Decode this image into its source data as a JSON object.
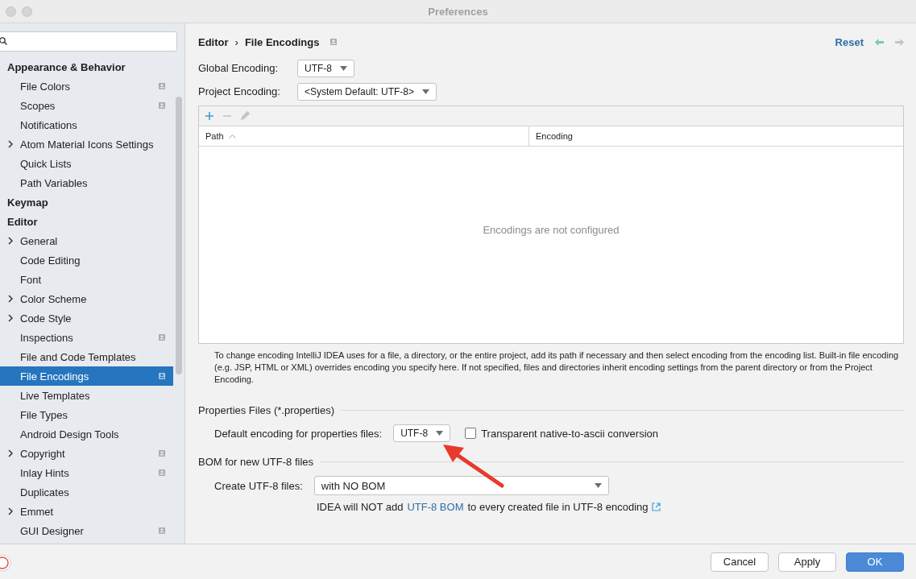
{
  "window": {
    "title": "Preferences"
  },
  "sidebar": {
    "items": [
      {
        "label": "Appearance & Behavior",
        "children": [
          {
            "label": "File Colors",
            "expandable": false,
            "badge": true,
            "selected": false
          },
          {
            "label": "Scopes",
            "expandable": false,
            "badge": true,
            "selected": false
          },
          {
            "label": "Notifications",
            "expandable": false,
            "badge": false,
            "selected": false
          },
          {
            "label": "Atom Material Icons Settings",
            "expandable": true,
            "badge": false,
            "selected": false
          },
          {
            "label": "Quick Lists",
            "expandable": false,
            "badge": false,
            "selected": false
          },
          {
            "label": "Path Variables",
            "expandable": false,
            "badge": false,
            "selected": false
          }
        ]
      },
      {
        "label": "Keymap"
      },
      {
        "label": "Editor",
        "children": [
          {
            "label": "General",
            "expandable": true,
            "badge": false,
            "selected": false
          },
          {
            "label": "Code Editing",
            "expandable": false,
            "badge": false,
            "selected": false
          },
          {
            "label": "Font",
            "expandable": false,
            "badge": false,
            "selected": false
          },
          {
            "label": "Color Scheme",
            "expandable": true,
            "badge": false,
            "selected": false
          },
          {
            "label": "Code Style",
            "expandable": true,
            "badge": false,
            "selected": false
          },
          {
            "label": "Inspections",
            "expandable": false,
            "badge": true,
            "selected": false
          },
          {
            "label": "File and Code Templates",
            "expandable": false,
            "badge": false,
            "selected": false
          },
          {
            "label": "File Encodings",
            "expandable": false,
            "badge": true,
            "selected": true
          },
          {
            "label": "Live Templates",
            "expandable": false,
            "badge": false,
            "selected": false
          },
          {
            "label": "File Types",
            "expandable": false,
            "badge": false,
            "selected": false
          },
          {
            "label": "Android Design Tools",
            "expandable": false,
            "badge": false,
            "selected": false
          },
          {
            "label": "Copyright",
            "expandable": true,
            "badge": true,
            "selected": false
          },
          {
            "label": "Inlay Hints",
            "expandable": false,
            "badge": true,
            "selected": false
          },
          {
            "label": "Duplicates",
            "expandable": false,
            "badge": false,
            "selected": false
          },
          {
            "label": "Emmet",
            "expandable": true,
            "badge": false,
            "selected": false
          },
          {
            "label": "GUI Designer",
            "expandable": false,
            "badge": true,
            "selected": false
          }
        ]
      }
    ]
  },
  "breadcrumb": [
    "Editor",
    "File Encodings"
  ],
  "breadcrumb_separator": "›",
  "reset": "Reset",
  "global_encoding": {
    "label": "Global Encoding:",
    "value": "UTF-8"
  },
  "project_encoding": {
    "label": "Project Encoding:",
    "value": "<System Default: UTF-8>"
  },
  "table": {
    "toolbar": {
      "add_disabled": false,
      "remove_disabled": true,
      "edit_disabled": true
    },
    "columns": [
      "Path",
      "Encoding"
    ],
    "empty_text": "Encodings are not configured"
  },
  "help_text": "To change encoding IntelliJ IDEA uses for a file, a directory, or the entire project, add its path if necessary and then select encoding from the encoding list. Built-in file encoding (e.g. JSP, HTML or XML) overrides encoding you specify here. If not specified, files and directories inherit encoding settings from the parent directory or from the Project Encoding.",
  "properties_section": {
    "title": "Properties Files (*.properties)",
    "label": "Default encoding for properties files:",
    "value": "UTF-8",
    "checkbox": {
      "label": "Transparent native-to-ascii conversion",
      "checked": false
    }
  },
  "bom_section": {
    "title": "BOM for new UTF-8 files",
    "label": "Create UTF-8 files:",
    "value": "with NO BOM",
    "note_before": "IDEA will NOT add",
    "note_link": "UTF-8 BOM",
    "note_after": "to every created file in UTF-8 encoding"
  },
  "buttons": [
    {
      "label": "Cancel",
      "primary": false
    },
    {
      "label": "Apply",
      "primary": false
    },
    {
      "label": "OK",
      "primary": true
    }
  ]
}
